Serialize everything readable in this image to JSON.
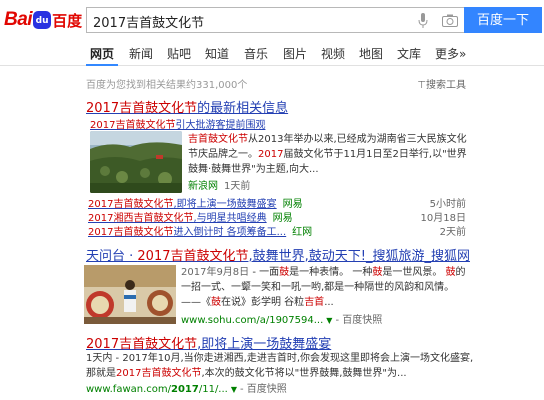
{
  "logo": {
    "text1": "Bai",
    "paw": "du",
    "text2": "百度"
  },
  "search": {
    "query": "2017吉首鼓文化节",
    "button": "百度一下"
  },
  "tabs": [
    "网页",
    "新闻",
    "贴吧",
    "知道",
    "音乐",
    "图片",
    "视频",
    "地图",
    "文库",
    "更多»"
  ],
  "result_count": "百度为您找到相关结果约331,000个",
  "tools_label": "搜索工具",
  "result1": {
    "title_em": "2017吉首鼓文化节",
    "title_rest": "的最新相关信息",
    "sub_em": "2017吉首鼓文化节",
    "sub_rest": "引大批游客提前围观",
    "text_em1": "吉首鼓文化节",
    "text_p1": "从2013年举办以来,已经成为湖南省三大民族文化节庆品牌之一。",
    "text_em2": "2017",
    "text_p2": "届鼓文化节于11月1日至2日举行,以\"世界鼓舞·鼓舞世界\"为主题,向大...",
    "source": "新浪网",
    "time": "1天前",
    "news": [
      {
        "em": "2017吉首鼓文化节",
        "rest": ",即将上演一场鼓舞盛宴",
        "source": "网易",
        "date": "5小时前"
      },
      {
        "em": "2017湘西吉首鼓文化节",
        "rest": ",与明星共唱经典",
        "source": "网易",
        "date": "10月18日"
      },
      {
        "em": "2017吉首鼓文化节",
        "rest": "进入倒计时 各项筹备工...",
        "source": "红网",
        "date": "2天前"
      }
    ]
  },
  "result2": {
    "title_p1": "天问台 · ",
    "title_em": "2017吉首鼓文化节",
    "title_p2": ",鼓舞世界,鼓动天下!_搜狐旅游_搜狐网",
    "date": "2017年9月8日",
    "text_p1": " - 一面",
    "text_em1": "鼓",
    "text_p2": "是一种表情。 一种",
    "text_em2": "鼓",
    "text_p3": "是一世风景。 ",
    "text_em3": "鼓",
    "text_p4": "的一招一式、一颦一笑和一吼一哟,都是一种隔世的风韵和风情。 ——《",
    "text_em4": "鼓",
    "text_p5": "在说》彭学明 谷粒",
    "text_em5": "吉首",
    "text_p6": "...",
    "url": "www.sohu.com/a/1907594...",
    "cache": "百度快照"
  },
  "result3": {
    "title_em": "2017吉首鼓文化节",
    "title_rest": ",即将上演一场鼓舞盛宴",
    "text_p1": "1天内 - 2017年10月,当你走进湘西,走进吉首时,你会发现这里即将会上演一场文化盛宴,那就是",
    "text_em1": "2017吉首鼓文化节",
    "text_p2": ",本次的鼓文化节将以\"世界鼓舞,鼓舞世界\"为...",
    "url_p1": "www.fawan.com/",
    "url_em": "2017",
    "url_p2": "/11/...",
    "cache": "百度快照"
  },
  "colors": {
    "accent": "#3385ff",
    "link": "#2440b3",
    "highlight": "#c00000",
    "url": "#008000"
  }
}
